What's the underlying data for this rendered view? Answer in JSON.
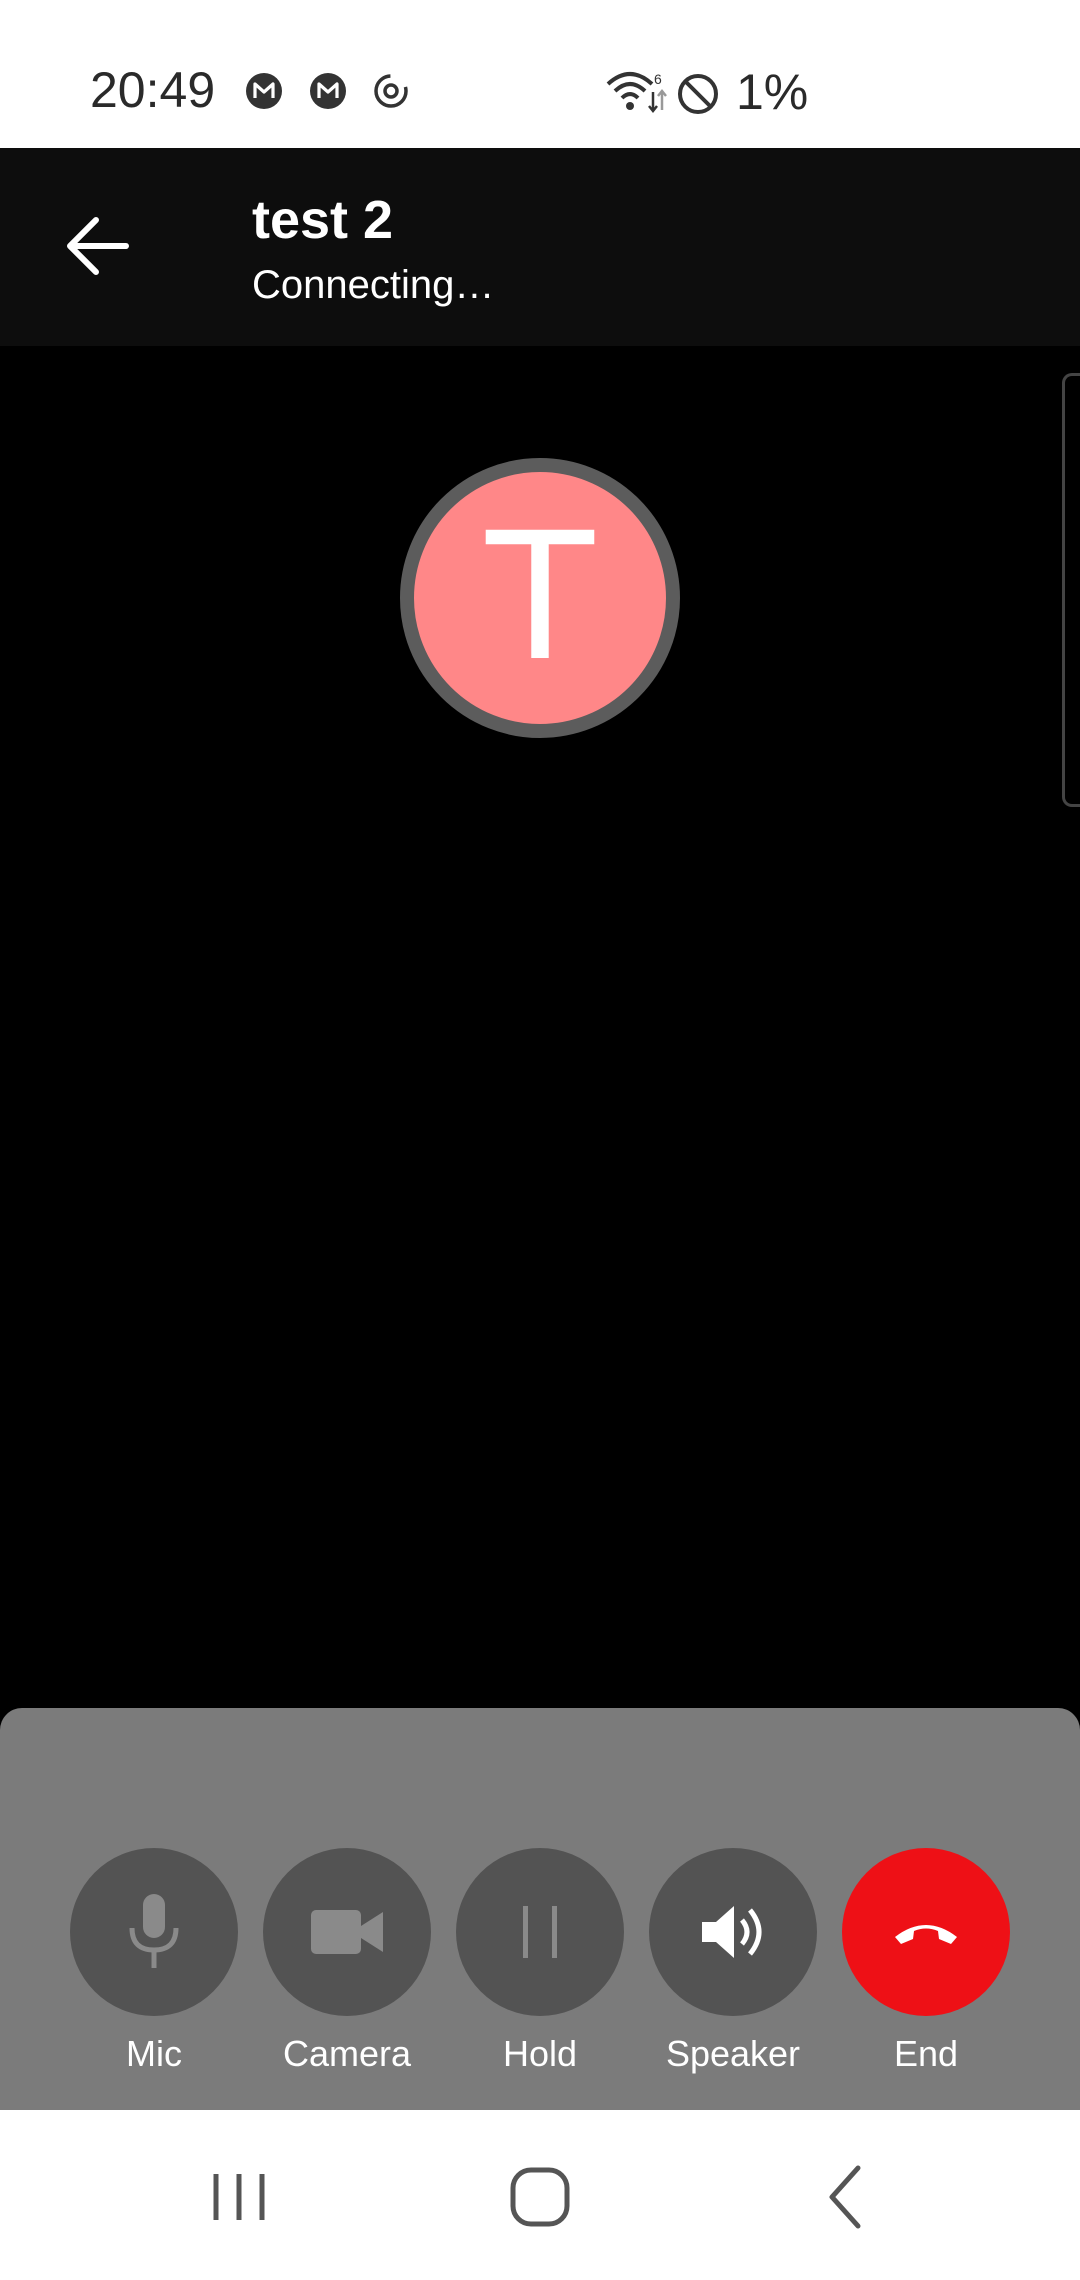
{
  "status_bar": {
    "time": "20:49",
    "notification_icons": [
      "gmail-icon",
      "gmail-icon",
      "sync-icon"
    ],
    "battery": "1%"
  },
  "header": {
    "contact_name": "test 2",
    "call_status": "Connecting…"
  },
  "avatar": {
    "initial": "T",
    "color": "#ff8788"
  },
  "controls": [
    {
      "label": "Mic",
      "icon": "mic-icon"
    },
    {
      "label": "Camera",
      "icon": "video-camera-icon"
    },
    {
      "label": "Hold",
      "icon": "pause-icon"
    },
    {
      "label": "Speaker",
      "icon": "speaker-icon"
    },
    {
      "label": "End",
      "icon": "hang-up-icon"
    }
  ],
  "colors": {
    "end_call": "#ee1016",
    "control_bg": "#535353",
    "panel_bg": "#7b7b7b"
  },
  "nav_bar": [
    "recent-apps-icon",
    "home-icon",
    "back-icon"
  ]
}
